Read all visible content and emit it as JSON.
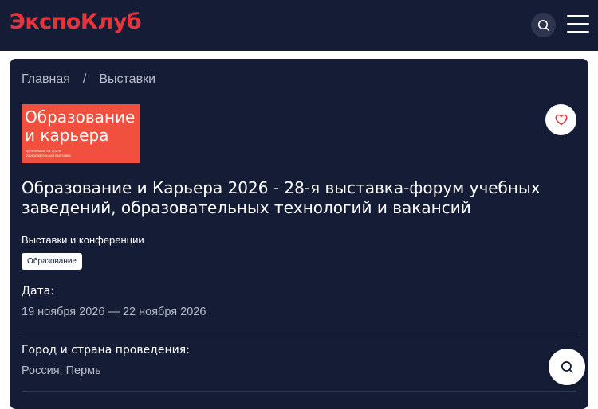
{
  "header": {
    "logo_text": "ЭкспоКлуб",
    "search_icon": "search-icon",
    "menu_icon": "hamburger-menu-icon"
  },
  "breadcrumb": {
    "items": [
      "Главная",
      "Выставки"
    ],
    "separator": "/"
  },
  "event": {
    "logo_title": "Образование и карьера",
    "logo_subtitle": "крупнейшая на Урале образовательная выставка",
    "favorite_icon": "heart-icon",
    "title": "Образование и Карьера 2026 - 28-я выставка-форум учебных заведений, образовательных технологий и вакансий",
    "category": "Выставки и конференции",
    "tag": "Образование",
    "details": [
      {
        "label": "Дата:",
        "value": "19 ноября 2026 — 22 ноября 2026"
      },
      {
        "label": "Город и страна проведения:",
        "value": "Россия, Пермь"
      }
    ]
  },
  "floating": {
    "search_icon": "search-icon"
  },
  "colors": {
    "background": "#151c36",
    "accent": "#e5343a",
    "event_logo_bg": "#f0503d",
    "muted_text": "#b9bdca"
  }
}
